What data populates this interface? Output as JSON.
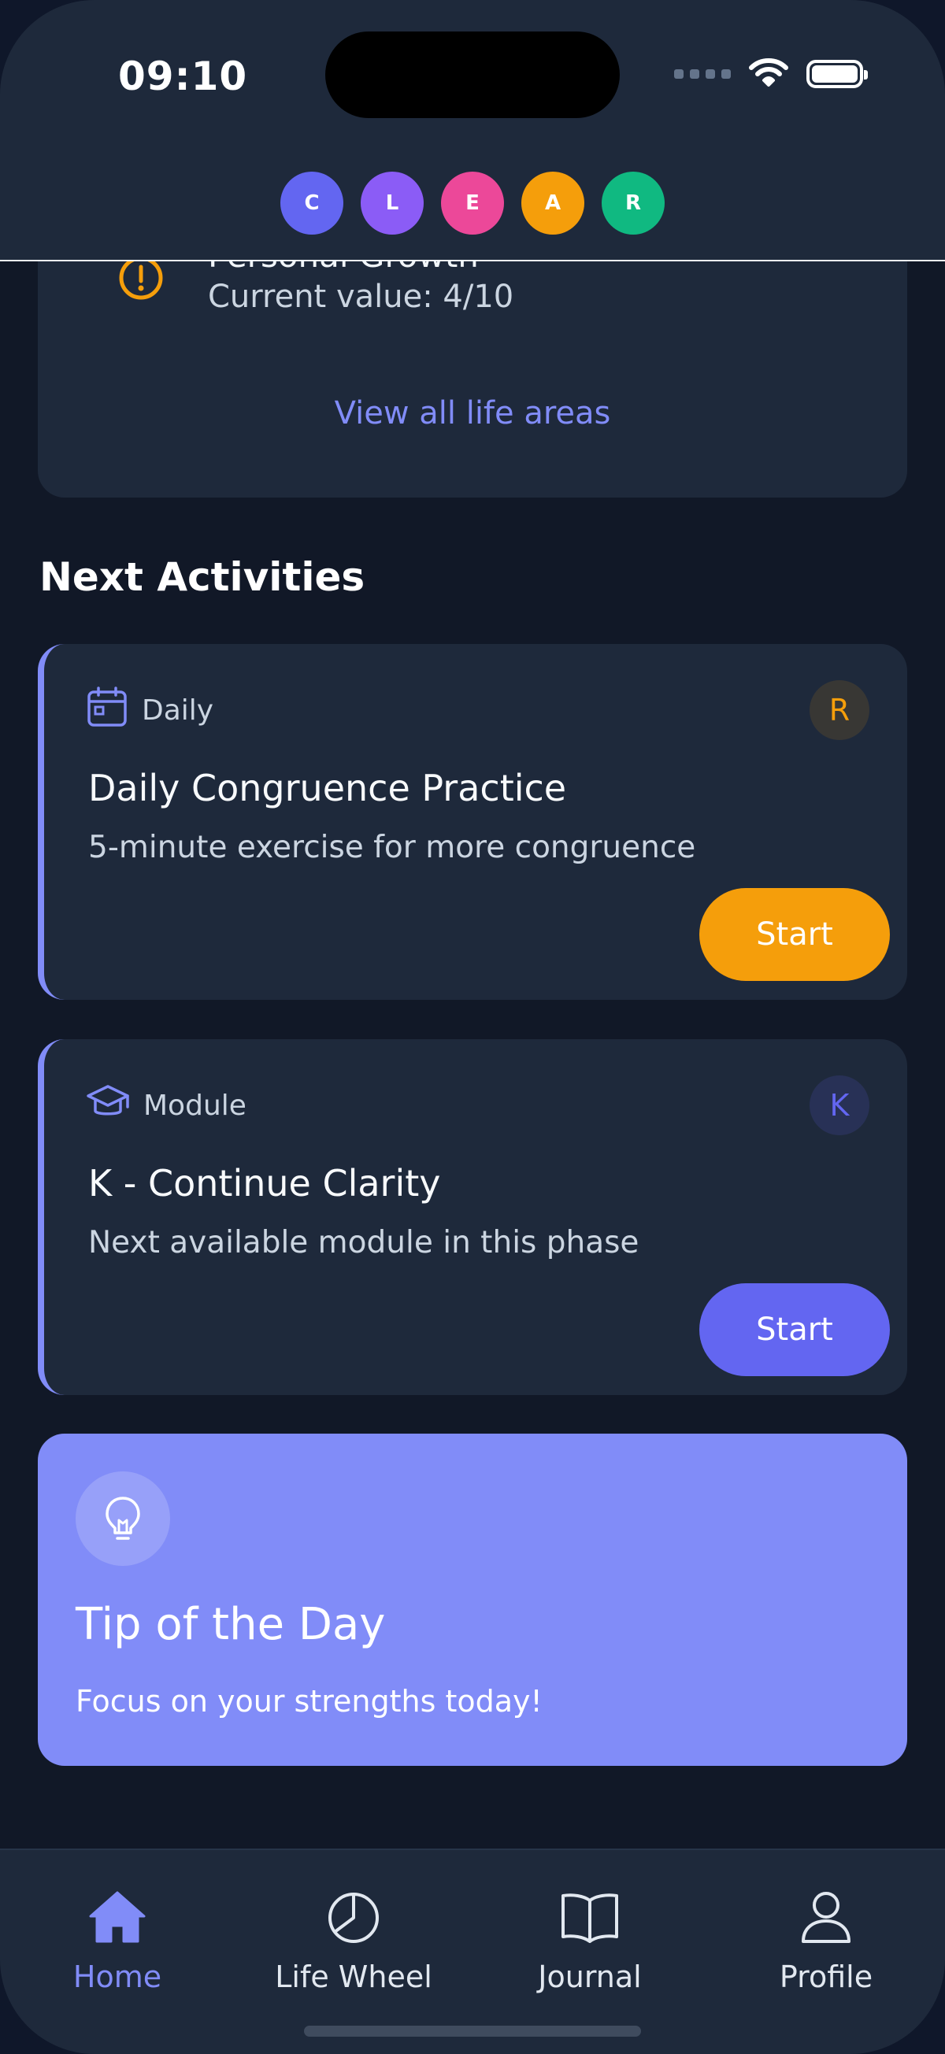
{
  "status_bar": {
    "time": "09:10"
  },
  "phases": [
    {
      "letter": "C",
      "color": "#6366f1"
    },
    {
      "letter": "L",
      "color": "#8b5cf6"
    },
    {
      "letter": "E",
      "color": "#ec4899"
    },
    {
      "letter": "A",
      "color": "#f59e0b"
    },
    {
      "letter": "R",
      "color": "#10b981"
    }
  ],
  "life_areas": {
    "area_name": "Personal Growth",
    "current_value": "Current value: 4/10",
    "view_all": "View all life areas",
    "warning_color": "#f59e0b"
  },
  "next_activities": {
    "title": "Next Activities",
    "items": [
      {
        "type": "Daily",
        "icon": "calendar-icon",
        "badge": "R",
        "badge_color": "#f59e0b",
        "title": "Daily Congruence Practice",
        "description": "5-minute exercise for more congruence",
        "button": "Start",
        "button_color": "#f59e0b"
      },
      {
        "type": "Module",
        "icon": "graduation-cap-icon",
        "badge": "K",
        "badge_color": "#6366f1",
        "title": "K - Continue Clarity",
        "description": "Next available module in this phase",
        "button": "Start",
        "button_color": "#6366f1"
      }
    ]
  },
  "tip": {
    "title": "Tip of the Day",
    "text": "Focus on your strengths today!",
    "icon": "lightbulb-icon"
  },
  "bottom_nav": [
    {
      "label": "Home",
      "icon": "home-icon",
      "active": true
    },
    {
      "label": "Life Wheel",
      "icon": "pie-chart-icon",
      "active": false
    },
    {
      "label": "Journal",
      "icon": "book-icon",
      "active": false
    },
    {
      "label": "Profile",
      "icon": "user-icon",
      "active": false
    }
  ]
}
